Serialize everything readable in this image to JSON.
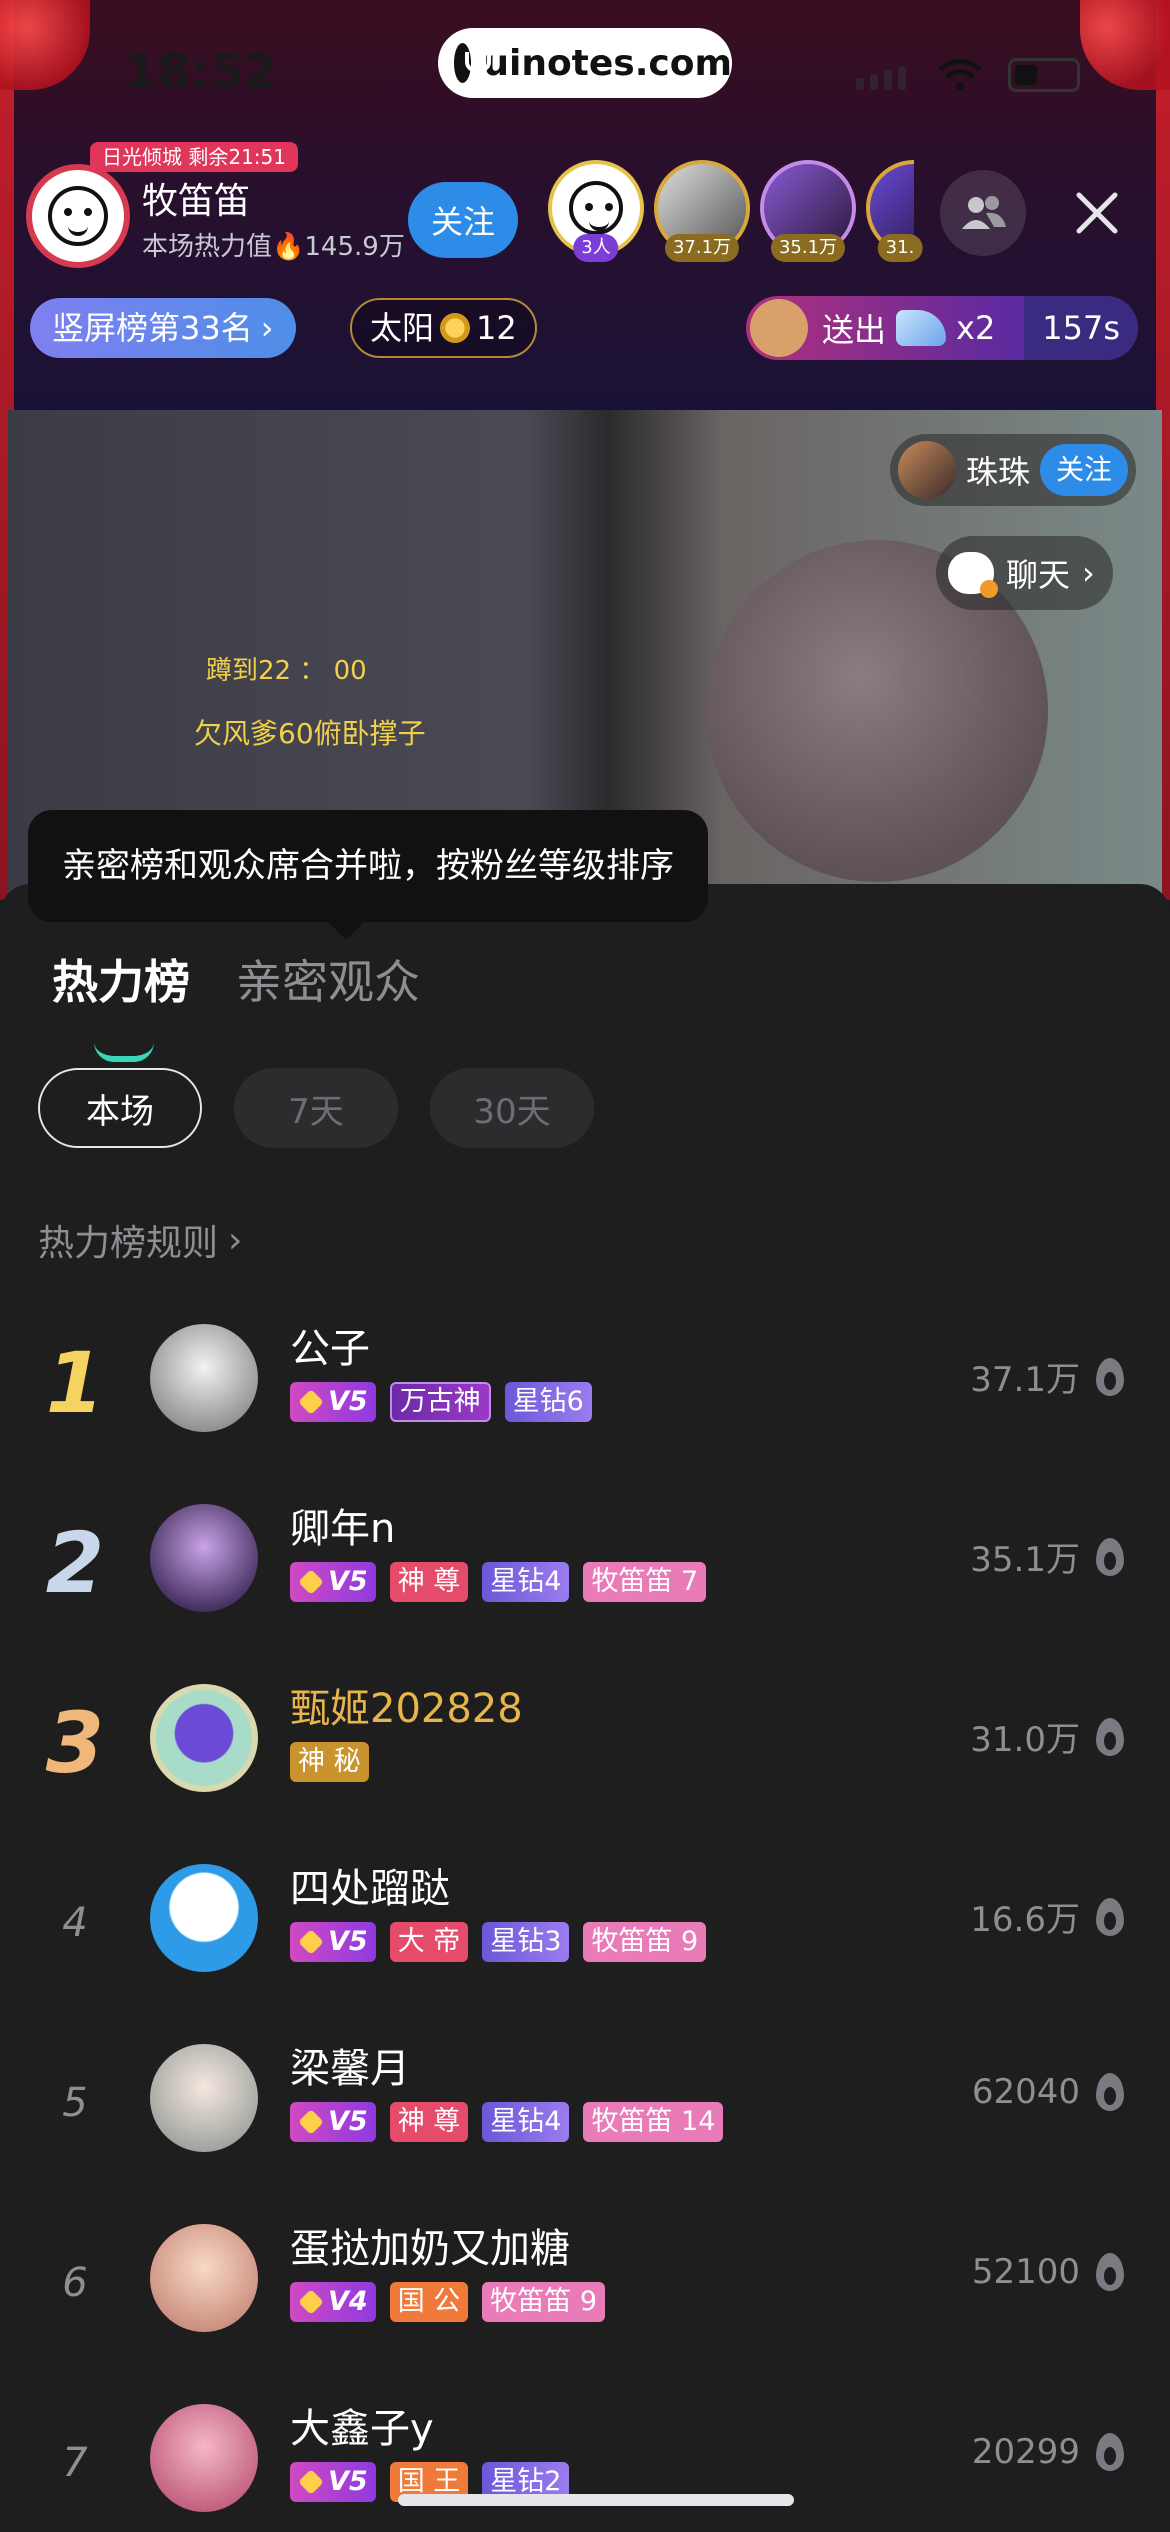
{
  "status": {
    "time": "18:52",
    "url": "uinotes.com"
  },
  "host": {
    "tag": "日光倾城 剩余21:51",
    "name": "牧笛笛",
    "heat_label": "本场热力值",
    "heat_value": "145.9万",
    "follow_label": "关注"
  },
  "audience_badges": [
    {
      "label": "3人"
    },
    {
      "label": "37.1万"
    },
    {
      "label": "35.1万"
    },
    {
      "label": "31."
    }
  ],
  "pills": {
    "rank": "竖屏榜第33名",
    "sun_label": "太阳",
    "sun_level": "12"
  },
  "gift": {
    "send_label": "送出",
    "count": "x2",
    "timer": "157s"
  },
  "video": {
    "text1": "蹲到22 ： 00",
    "text2": "欠风爹60俯卧撑子",
    "streamer_name": "珠珠",
    "streamer_follow": "关注",
    "chat_label": "聊天"
  },
  "tooltip": "亲密榜和观众席合并啦，按粉丝等级排序",
  "tabs": [
    {
      "label": "热力榜"
    },
    {
      "label": "亲密观众"
    }
  ],
  "periods": [
    {
      "label": "本场"
    },
    {
      "label": "7天"
    },
    {
      "label": "30天"
    }
  ],
  "rules_label": "热力榜规则",
  "rows": [
    {
      "rank": "1",
      "name": "公子",
      "heat": "37.1万",
      "badges": [
        "V5",
        "万古神",
        "星钻6"
      ]
    },
    {
      "rank": "2",
      "name": "卿年n",
      "heat": "35.1万",
      "badges": [
        "V5",
        "神 尊",
        "星钻4",
        "牧笛笛 7"
      ]
    },
    {
      "rank": "3",
      "name": "甄姬202828",
      "heat": "31.0万",
      "badges": [
        "神 秘"
      ]
    },
    {
      "rank": "4",
      "name": "四处蹓跶",
      "heat": "16.6万",
      "badges": [
        "V5",
        "大 帝",
        "星钻3",
        "牧笛笛 9"
      ]
    },
    {
      "rank": "5",
      "name": "梁馨月",
      "heat": "62040",
      "badges": [
        "V5",
        "神 尊",
        "星钻4",
        "牧笛笛 14"
      ]
    },
    {
      "rank": "6",
      "name": "蛋挞加奶又加糖",
      "heat": "52100",
      "badges": [
        "V4",
        "国 公",
        "牧笛笛 9"
      ]
    },
    {
      "rank": "7",
      "name": "大鑫子y",
      "heat": "20299",
      "badges": [
        "V5",
        "国 王",
        "星钻2"
      ]
    }
  ]
}
